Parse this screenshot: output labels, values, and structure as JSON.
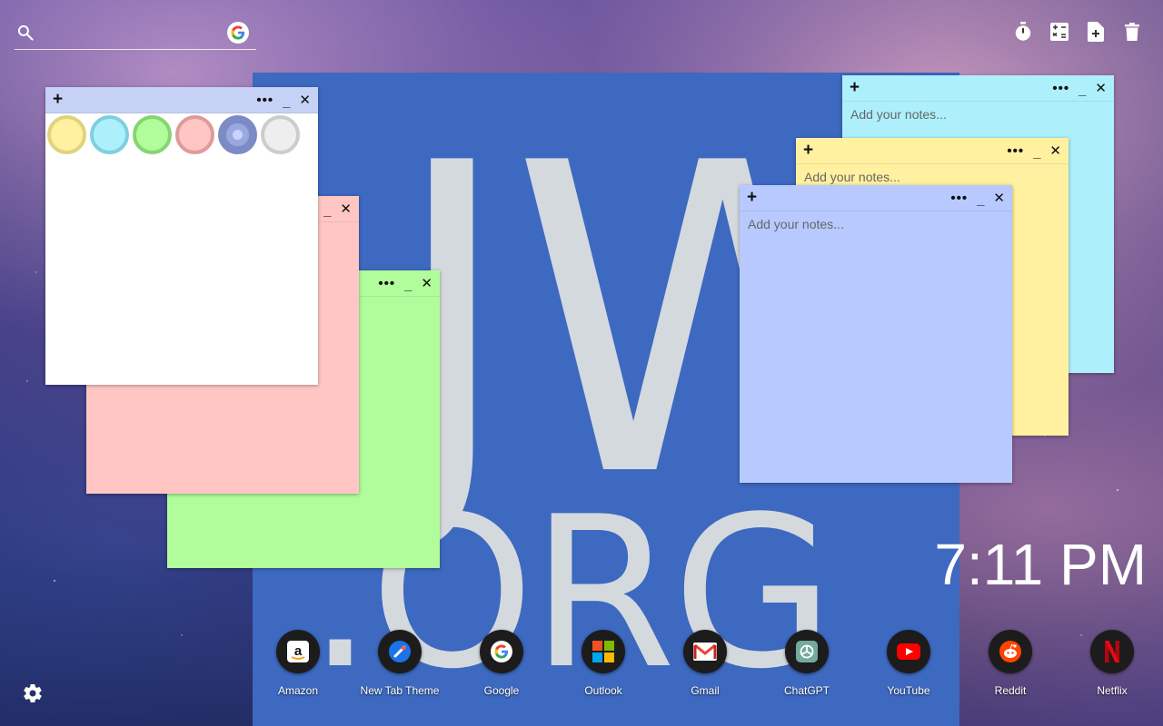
{
  "background": {
    "big_text_1": "JW",
    "big_text_2": ".ORG"
  },
  "search": {
    "placeholder": "",
    "icon": "search-icon",
    "engine_icon": "google-icon"
  },
  "toolbar": {
    "icons": [
      "timer-icon",
      "calculator-icon",
      "add-note-icon",
      "delete-icon"
    ]
  },
  "notes": {
    "white": {
      "color": "#ffffff",
      "header_color": "#c5d1f5"
    },
    "pink": {
      "color": "#ffc6c4",
      "placeholder": ""
    },
    "green": {
      "color": "#b1fd9c",
      "placeholder": ""
    },
    "cyan": {
      "color": "#adf0fc",
      "placeholder": "Add your notes..."
    },
    "yellow": {
      "color": "#fff1a0",
      "placeholder": "Add your notes..."
    },
    "blue": {
      "color": "#b8c9ff",
      "placeholder": "Add your notes..."
    },
    "buttons": {
      "plus": "+",
      "menu": "•••",
      "minimize": "_",
      "close": "✕"
    }
  },
  "palette": [
    {
      "name": "yellow",
      "fill": "#fff1a0",
      "border": "#dfd37b"
    },
    {
      "name": "cyan",
      "fill": "#adf0fc",
      "border": "#7fcfe0"
    },
    {
      "name": "green",
      "fill": "#b1fd9c",
      "border": "#86d472"
    },
    {
      "name": "pink",
      "fill": "#ffc6c4",
      "border": "#de9b99"
    },
    {
      "name": "blue",
      "fill": "#9aa8e0",
      "border": "#7c8bc6"
    },
    {
      "name": "gray",
      "fill": "#eeeeee",
      "border": "#cccccc"
    }
  ],
  "clock": {
    "time": "7:11 PM"
  },
  "shortcuts": [
    {
      "label": "Amazon",
      "icon": "amazon-icon"
    },
    {
      "label": "New Tab Theme",
      "icon": "new-tab-theme-icon"
    },
    {
      "label": "Google",
      "icon": "google-icon"
    },
    {
      "label": "Outlook",
      "icon": "outlook-icon"
    },
    {
      "label": "Gmail",
      "icon": "gmail-icon"
    },
    {
      "label": "ChatGPT",
      "icon": "chatgpt-icon"
    },
    {
      "label": "YouTube",
      "icon": "youtube-icon"
    },
    {
      "label": "Reddit",
      "icon": "reddit-icon"
    },
    {
      "label": "Netflix",
      "icon": "netflix-icon"
    }
  ],
  "settings": {
    "icon": "gear-icon"
  }
}
